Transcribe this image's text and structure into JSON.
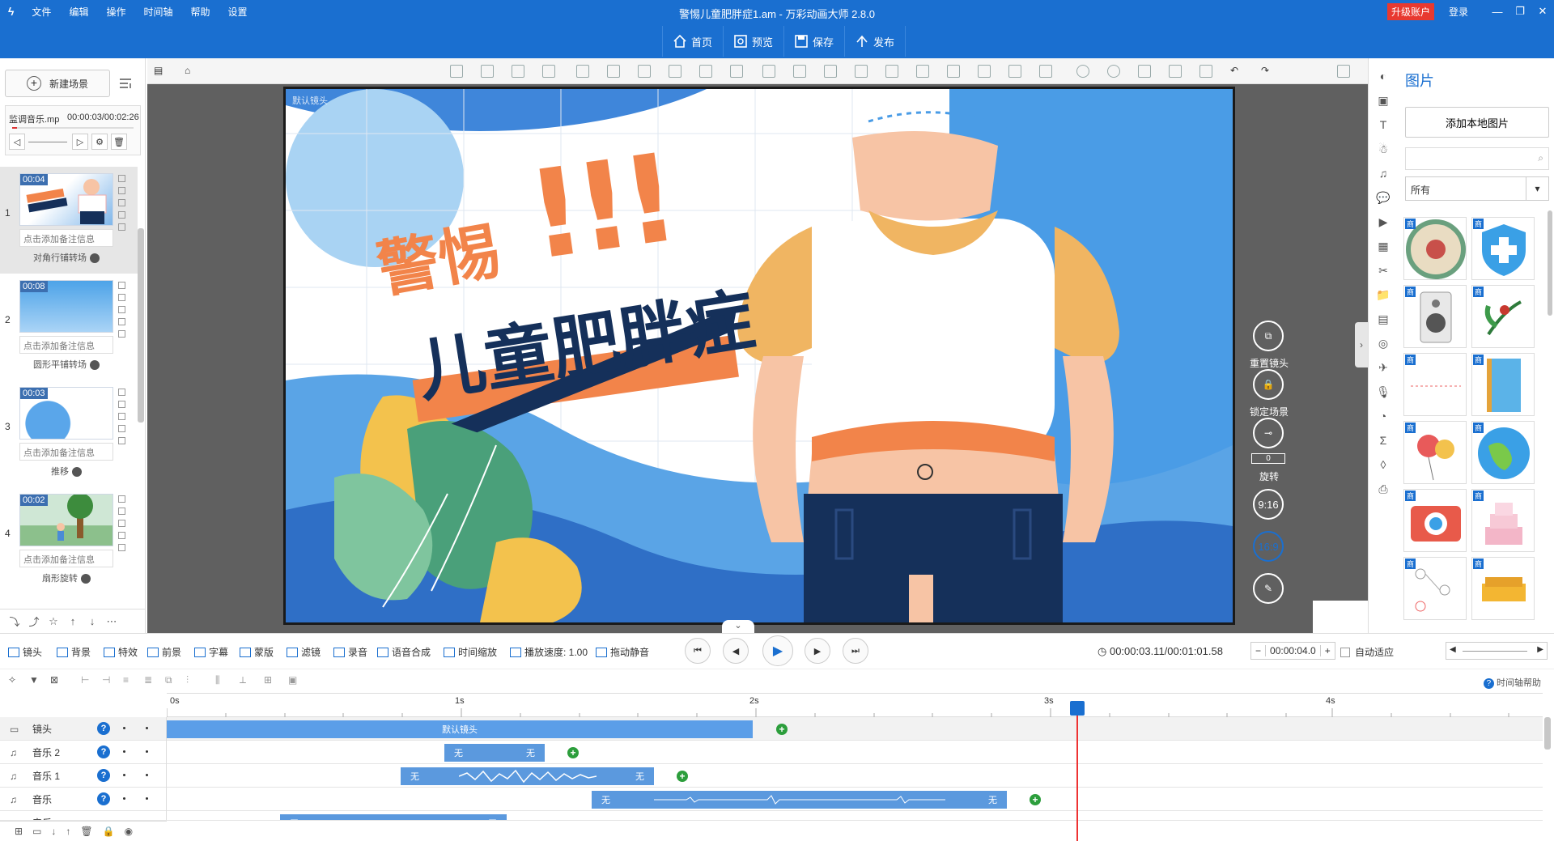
{
  "titlebar": {
    "menu": [
      "文件",
      "编辑",
      "操作",
      "时间轴",
      "帮助",
      "设置"
    ],
    "title": "警惕儿童肥胖症1.am - 万彩动画大师 2.8.0",
    "upgrade": "升级账户",
    "login": "登录",
    "toolbar": {
      "home": "首页",
      "preview": "预览",
      "save": "保存",
      "publish": "发布"
    }
  },
  "left": {
    "new_scene": "新建场景",
    "audio_name": "监调音乐.mp",
    "audio_time": "00:00:03/00:02:26",
    "scenes": [
      {
        "num": "1",
        "duration": "00:04",
        "note": "点击添加备注信息",
        "transition": "对角行铺转场"
      },
      {
        "num": "2",
        "duration": "00:08",
        "note": "点击添加备注信息",
        "transition": "圆形平铺转场"
      },
      {
        "num": "3",
        "duration": "00:03",
        "note": "点击添加备注信息",
        "transition": "推移"
      },
      {
        "num": "4",
        "duration": "00:02",
        "note": "点击添加备注信息",
        "transition": "扇形旋转"
      }
    ]
  },
  "stage": {
    "camera_label": "默认镜头",
    "headline": "警惕",
    "exclaim": "!!!",
    "subhead": "儿童肥胖症"
  },
  "right_controls": {
    "reset_camera": "重置镜头",
    "lock_scene": "锁定场景",
    "rotate_value": "0",
    "rotate": "旋转",
    "ratio_portrait": "9:16",
    "ratio_landscape": "16:9"
  },
  "library": {
    "title": "图片",
    "add_local": "添加本地图片",
    "filter": "所有",
    "tag": "商"
  },
  "timeline": {
    "tools": [
      "镜头",
      "背景",
      "特效",
      "前景",
      "字幕",
      "蒙版",
      "滤镜",
      "录音",
      "语音合成",
      "时间缩放",
      "播放速度: 1.00",
      "拖动静音"
    ],
    "time": "00:00:03.11/00:01:01.58",
    "zoom_value": "00:00:04.0",
    "auto_fit": "自动适应",
    "help": "时间轴帮助",
    "ruler": [
      "0s",
      "1s",
      "2s",
      "3s",
      "4s"
    ],
    "tracks": [
      {
        "name": "镜头",
        "clips": [
          "默认镜头"
        ]
      },
      {
        "name": "音乐 2",
        "clips": [
          "无",
          "无"
        ]
      },
      {
        "name": "音乐 1",
        "clips": [
          "无",
          "无"
        ]
      },
      {
        "name": "音乐",
        "clips": [
          "无",
          "无"
        ]
      },
      {
        "name": "音乐",
        "clips": [
          "无",
          "无"
        ]
      }
    ],
    "playhead_seconds": 3.11
  },
  "colors": {
    "brand": "#1a6fd0",
    "accent": "#f2844a",
    "navy": "#15305a"
  }
}
